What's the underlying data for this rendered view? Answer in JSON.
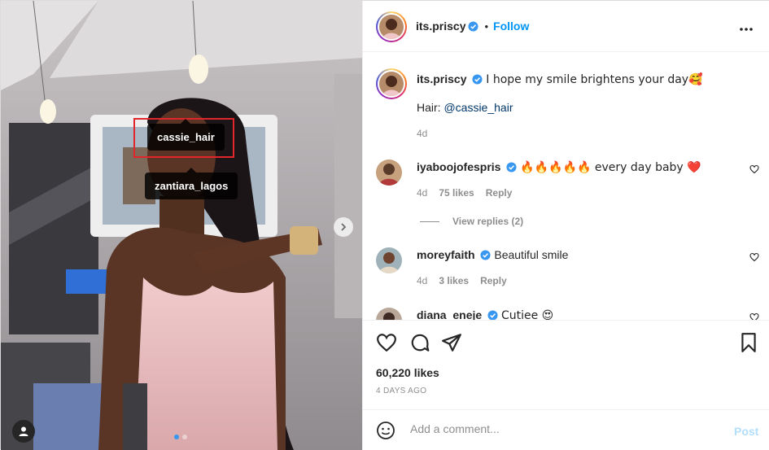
{
  "post": {
    "author": "its.priscy",
    "follow_label": "Follow",
    "header_separator": "•",
    "caption": "I hope my smile brightens your day🥰",
    "caption_line2_prefix": "Hair: ",
    "caption_mention": "@cassie_hair",
    "caption_age": "4d",
    "likes": "60,220 likes",
    "date": "4 DAYS AGO"
  },
  "media": {
    "tags": [
      "cassie_hair",
      "zantiara_lagos"
    ],
    "slide_count": 2,
    "active_slide": 1
  },
  "comments": [
    {
      "user": "iyaboojofespris",
      "verified": true,
      "text": "🔥🔥🔥🔥🔥 every day baby ❤️",
      "age": "4d",
      "likes": "75 likes",
      "reply": "Reply",
      "view_replies": "View replies (2)"
    },
    {
      "user": "moreyfaith",
      "verified": true,
      "text": "Beautiful smile",
      "age": "4d",
      "likes": "3 likes",
      "reply": "Reply"
    },
    {
      "user": "diana_eneje",
      "verified": true,
      "text": "Cutiee 😍"
    }
  ],
  "composer": {
    "placeholder": "Add a comment...",
    "post_label": "Post"
  },
  "colors": {
    "accent": "#0095f6",
    "verified": "#3897f0",
    "post_disabled": "#b2dffc",
    "tag_highlight": "#e0252b"
  },
  "icons": [
    "more-icon",
    "heart-icon",
    "comment-icon",
    "share-icon",
    "bookmark-icon",
    "emoji-icon",
    "next-arrow-icon",
    "user-tags-icon",
    "verified-badge-icon"
  ]
}
